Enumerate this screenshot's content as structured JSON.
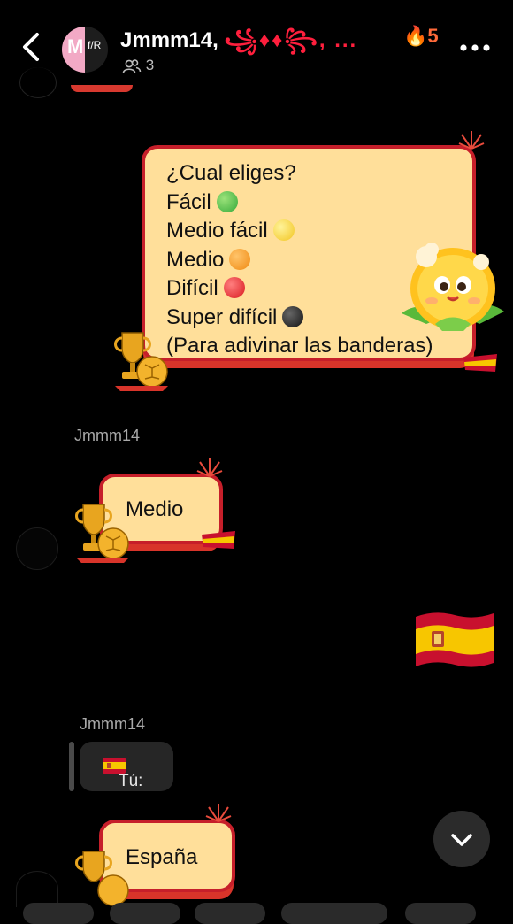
{
  "header": {
    "back_icon": "chevron-left-icon",
    "avatar_letter": "M",
    "avatar_mark": "f/R",
    "title": "Jmmm14, ",
    "title_deco": "꧁♦♦꧂, ...",
    "streak_icon": "🔥",
    "streak_count": "5",
    "members_count": "3",
    "more_icon": "more-dots-icon"
  },
  "messages": {
    "question": {
      "lines": [
        "¿Cual eliges?",
        "Fácil",
        "Medio fácil",
        "Medio",
        "Difícil",
        "Super difícil",
        "(Para adivinar las banderas)"
      ],
      "dot_colors": [
        "",
        "#35a93a",
        "#f2c521",
        "#f08a12",
        "#d9191f",
        "#121212",
        ""
      ]
    },
    "sender_1": "Jmmm14",
    "reply_1": "Medio",
    "sent_flag": "🇪🇸",
    "sender_2": "Jmmm14",
    "quote_label": "Tú:",
    "quote_flag": "🇪🇸",
    "reply_2": "España"
  },
  "colors": {
    "bubble_fill": "#ffdf9a",
    "bubble_border": "#c61f2a",
    "background": "#000000",
    "spain_red": "#c8102e",
    "spain_yellow": "#f7c600"
  },
  "scroll_button_icon": "chevron-down-icon"
}
